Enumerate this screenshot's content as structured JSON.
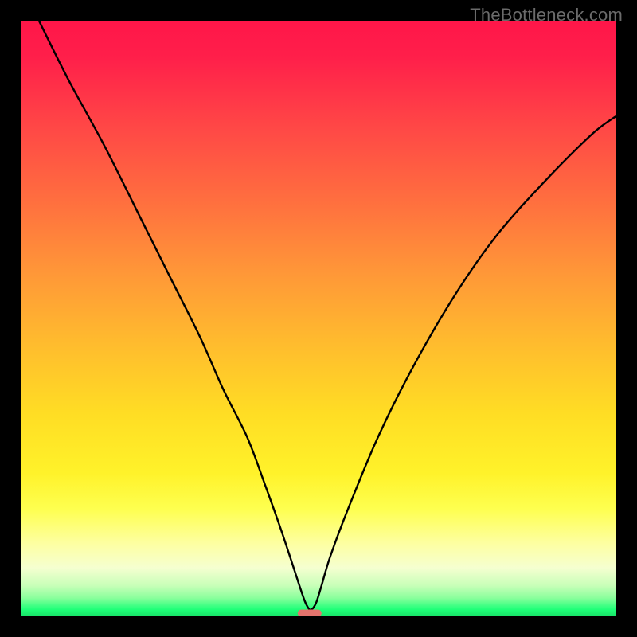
{
  "watermark": "TheBottleneck.com",
  "chart_data": {
    "type": "line",
    "title": "",
    "xlabel": "",
    "ylabel": "",
    "xlim": [
      0,
      100
    ],
    "ylim": [
      0,
      100
    ],
    "grid": false,
    "legend": false,
    "series": [
      {
        "name": "curve",
        "x": [
          3,
          8,
          14,
          20,
          25,
          30,
          34,
          38,
          41,
          43.5,
          45.5,
          46.8,
          47.7,
          48.2,
          48.5,
          48.8,
          49.2,
          49.7,
          50.5,
          52,
          55,
          60,
          66,
          73,
          80,
          88,
          96,
          100
        ],
        "y": [
          100,
          90,
          79,
          67,
          57,
          47,
          38,
          30,
          22,
          15,
          9,
          5,
          2.4,
          1.4,
          1,
          1,
          1.4,
          2.4,
          5,
          10,
          18,
          30,
          42,
          54,
          64,
          73,
          81,
          84
        ]
      }
    ],
    "background_gradient": {
      "direction": "vertical",
      "stops": [
        {
          "pos": 0.0,
          "color": "#ff1649"
        },
        {
          "pos": 0.3,
          "color": "#ff6e3f"
        },
        {
          "pos": 0.6,
          "color": "#ffdd24"
        },
        {
          "pos": 0.88,
          "color": "#fdffa3"
        },
        {
          "pos": 0.97,
          "color": "#8cff9d"
        },
        {
          "pos": 1.0,
          "color": "#19e66a"
        }
      ]
    },
    "marker": {
      "x": 48.5,
      "y": 0.4,
      "shape": "pill",
      "color": "#e4736d"
    }
  }
}
